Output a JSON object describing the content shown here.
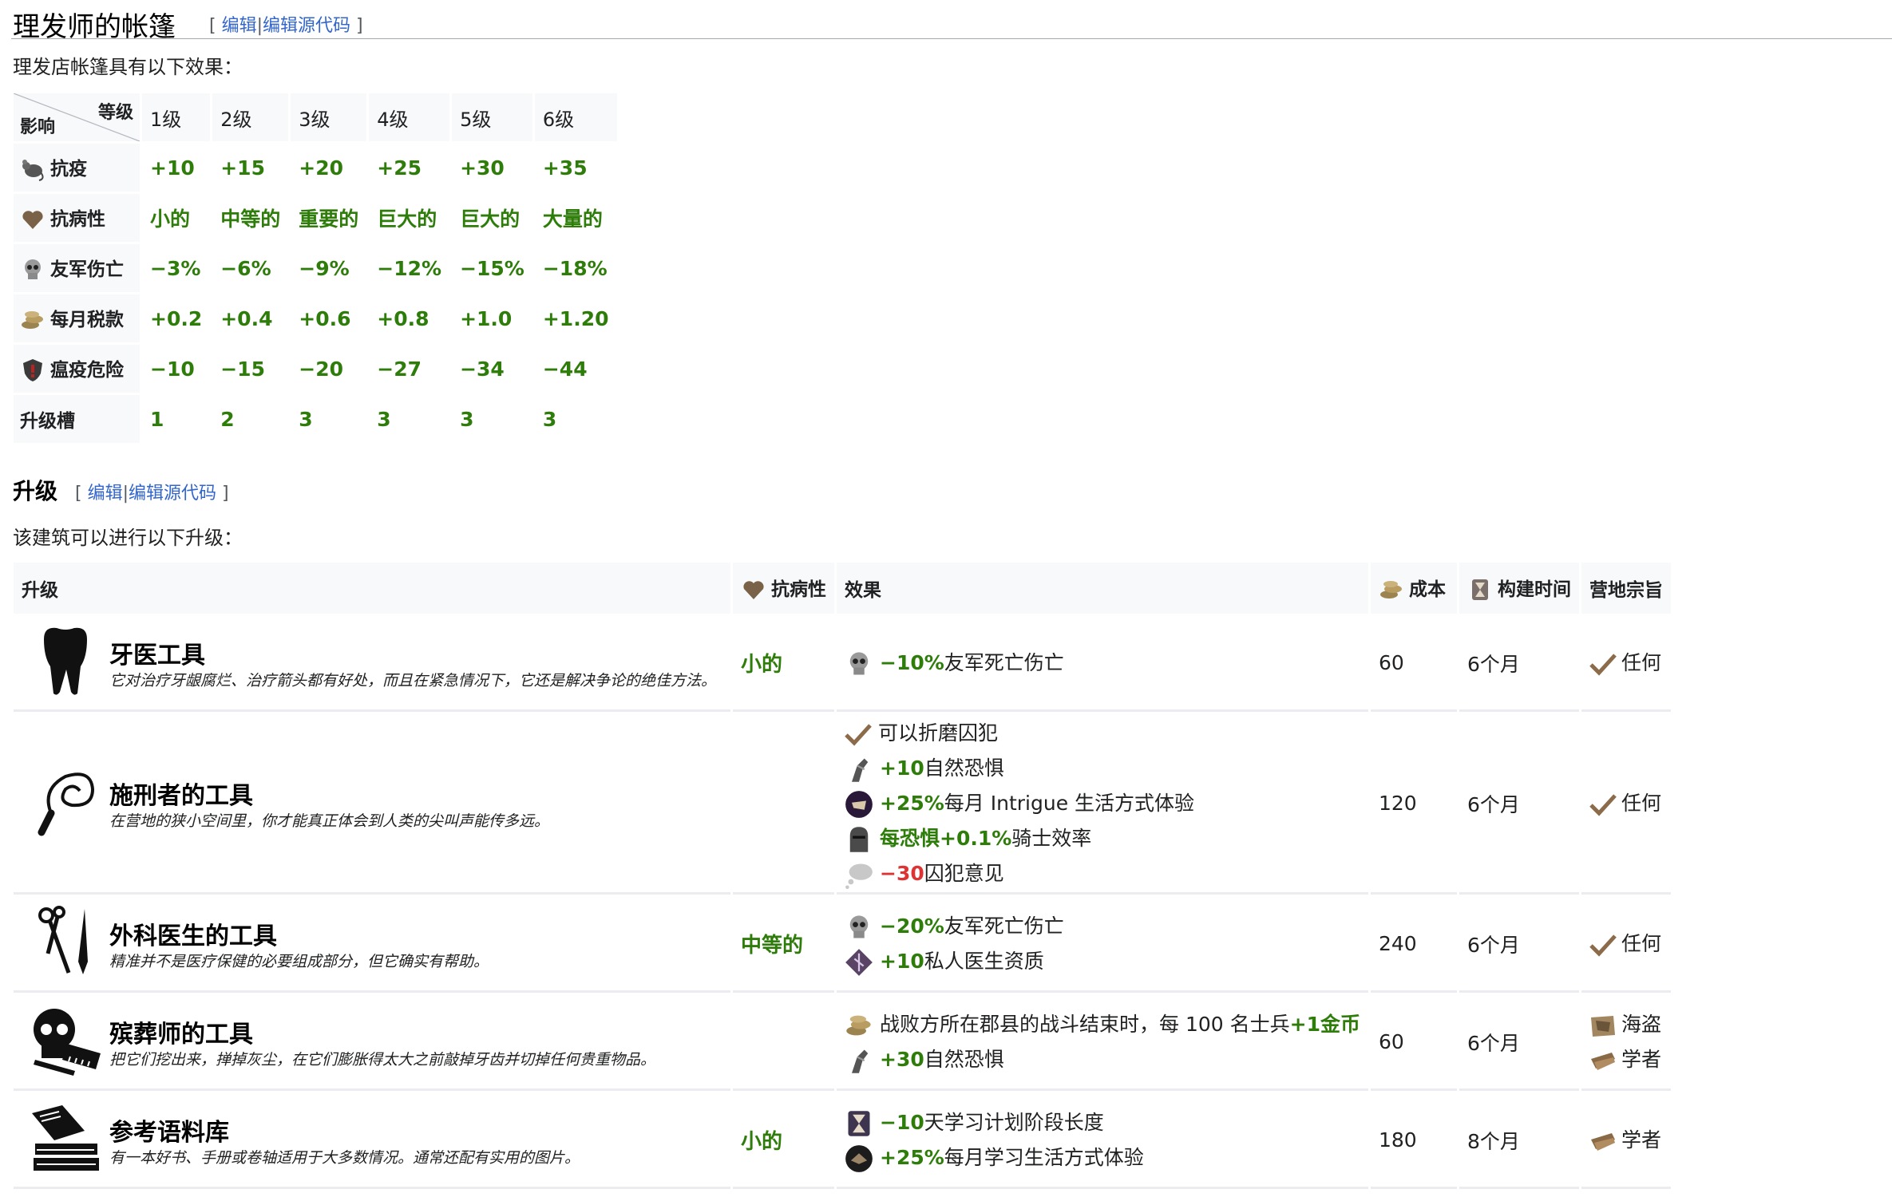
{
  "section1": {
    "title": "理发师的帐篷",
    "edit_bracket_open": "[",
    "edit_label": "编辑",
    "edit_sep": "|",
    "edit_source_label": "编辑源代码",
    "edit_bracket_close": "]",
    "intro": "理发店帐篷具有以下效果："
  },
  "effects_table": {
    "corner_top": "等级",
    "corner_bottom": "影响",
    "levels": [
      "1级",
      "2级",
      "3级",
      "4级",
      "5级",
      "6级"
    ],
    "rows": [
      {
        "icon": "rat-icon",
        "label": "抗疫",
        "values": [
          "+10",
          "+15",
          "+20",
          "+25",
          "+30",
          "+35"
        ]
      },
      {
        "icon": "heart-icon",
        "label": "抗病性",
        "values": [
          "小的",
          "中等的",
          "重要的",
          "巨大的",
          "巨大的",
          "大量的"
        ]
      },
      {
        "icon": "skull-icon",
        "label": "友军伤亡",
        "values": [
          "−3%",
          "−6%",
          "−9%",
          "−12%",
          "−15%",
          "−18%"
        ]
      },
      {
        "icon": "coins-icon",
        "label": "每月税款",
        "values": [
          "+0.2",
          "+0.4",
          "+0.6",
          "+0.8",
          "+1.0",
          "+1.20"
        ]
      },
      {
        "icon": "shield-icon",
        "label": "瘟疫危险",
        "values": [
          "−10",
          "−15",
          "−20",
          "−27",
          "−34",
          "−44"
        ]
      },
      {
        "icon": "",
        "label": "升级槽",
        "values": [
          "1",
          "2",
          "3",
          "3",
          "3",
          "3"
        ]
      }
    ]
  },
  "section2": {
    "title": "升级",
    "edit_bracket_open": "[",
    "edit_label": "编辑",
    "edit_sep": "|",
    "edit_source_label": "编辑源代码",
    "edit_bracket_close": "]",
    "intro": "该建筑可以进行以下升级："
  },
  "upgrades_table": {
    "headers": {
      "upgrade": "升级",
      "resistance": "抗病性",
      "effect": "效果",
      "cost": "成本",
      "build_time": "构建时间",
      "camp_purpose": "营地宗旨"
    },
    "rows": [
      {
        "icon": "tooth-icon",
        "name": "牙医工具",
        "desc": "它对治疗牙龈腐烂、治疗箭头都有好处，而且在紧急情况下，它还是解决争论的绝佳方法。",
        "resistance": "小的",
        "effects": [
          {
            "icon": "skull-icon",
            "value": "−10%",
            "text": "友军死亡伤亡"
          }
        ],
        "cost": "60",
        "time": "6个月",
        "camp": [
          {
            "icon": "check-icon",
            "text": "任何"
          }
        ]
      },
      {
        "icon": "whip-icon",
        "name": "施刑者的工具",
        "desc": "在营地的狭小空间里，你才能真正体会到人类的尖叫声能传多远。",
        "resistance": "",
        "effects": [
          {
            "icon": "check-icon",
            "value": "",
            "text": "可以折磨囚犯"
          },
          {
            "icon": "dread-icon",
            "value": "+10",
            "text": "自然恐惧"
          },
          {
            "icon": "intrigue-icon",
            "value": "+25%",
            "text": "每月 Intrigue 生活方式体验"
          },
          {
            "icon": "knight-icon",
            "value": "每恐惧+0.1%",
            "text": "骑士效率"
          },
          {
            "icon": "opinion-icon",
            "value": "−30",
            "text": "囚犯意见"
          }
        ],
        "cost": "120",
        "time": "6个月",
        "camp": [
          {
            "icon": "check-icon",
            "text": "任何"
          }
        ]
      },
      {
        "icon": "scissors-icon",
        "name": "外科医生的工具",
        "desc": "精准并不是医疗保健的必要组成部分，但它确实有帮助。",
        "resistance": "中等的",
        "effects": [
          {
            "icon": "skull-icon",
            "value": "−20%",
            "text": "友军死亡伤亡"
          },
          {
            "icon": "physician-icon",
            "value": "+10",
            "text": "私人医生资质"
          }
        ],
        "cost": "240",
        "time": "6个月",
        "camp": [
          {
            "icon": "check-icon",
            "text": "任何"
          }
        ]
      },
      {
        "icon": "skull-comb-icon",
        "name": "殡葬师的工具",
        "desc": "把它们挖出来，掸掉灰尘，在它们膨胀得太大之前敲掉牙齿并切掉任何贵重物品。",
        "resistance": "",
        "effects": [
          {
            "icon": "coins-icon",
            "value": "",
            "text": "战败方所在郡县的战斗结束时，每 100 名士兵",
            "suffix": "+1金币"
          },
          {
            "icon": "dread-icon",
            "value": "+30",
            "text": "自然恐惧"
          }
        ],
        "cost": "60",
        "time": "6个月",
        "camp": [
          {
            "icon": "pirate-icon",
            "text": "海盗"
          },
          {
            "icon": "scholar-icon",
            "text": "学者"
          }
        ]
      },
      {
        "icon": "books-icon",
        "name": "参考语料库",
        "desc": "有一本好书、手册或卷轴适用于大多数情况。通常还配有实用的图片。",
        "resistance": "小的",
        "effects": [
          {
            "icon": "hourglass-icon",
            "value": "−10",
            "text": "天学习计划阶段长度"
          },
          {
            "icon": "learning-icon",
            "value": "+25%",
            "text": "每月学习生活方式体验"
          }
        ],
        "cost": "180",
        "time": "8个月",
        "camp": [
          {
            "icon": "scholar-icon",
            "text": "学者"
          }
        ]
      }
    ]
  }
}
